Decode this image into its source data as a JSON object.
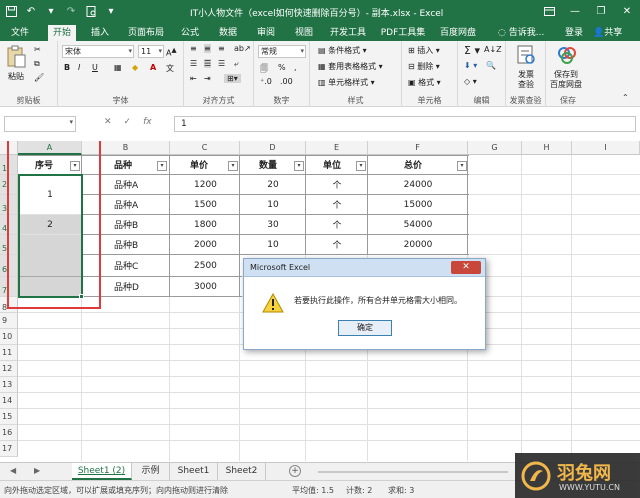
{
  "window": {
    "title": "IT小人物文件（excel如何快速删除百分号）- 副本.xlsx - Excel",
    "share_label": "共享",
    "login_label": "登录",
    "tell_me_placeholder": "告诉我..."
  },
  "tabs": [
    "文件",
    "开始",
    "插入",
    "页面布局",
    "公式",
    "数据",
    "审阅",
    "视图",
    "开发工具",
    "PDF工具集",
    "百度网盘"
  ],
  "active_tab": "开始",
  "ribbon": {
    "paste_label": "粘贴",
    "clipboard_label": "剪贴板",
    "font_name": "宋体",
    "font_size": "11",
    "font_label": "字体",
    "align_label": "对齐方式",
    "number_format": "常规",
    "number_label": "数字",
    "cond_format": "条件格式",
    "table_format": "套用表格格式",
    "cell_style": "单元格样式",
    "styles_label": "样式",
    "insert_label": "插入",
    "delete_label": "删除",
    "format_label": "格式",
    "cells_label": "单元格",
    "edit_label": "编辑",
    "invoice_label": "发票\n查验",
    "invoice_l1": "发票",
    "invoice_l2": "查验",
    "invoice_group": "发票查验",
    "save_l1": "保存到",
    "save_l2": "百度网盘",
    "save_group": "保存"
  },
  "formula_bar": {
    "name_box": "",
    "formula": "1",
    "fx": "fx"
  },
  "columns": [
    "A",
    "B",
    "C",
    "D",
    "E",
    "F",
    "G",
    "H",
    "I"
  ],
  "rows": [
    "1",
    "2",
    "3",
    "4",
    "5",
    "6",
    "7",
    "8",
    "9",
    "10",
    "11",
    "12",
    "13",
    "14",
    "15",
    "16",
    "17"
  ],
  "table": {
    "headers": [
      "序号",
      "品种",
      "单价",
      "数量",
      "单位",
      "总价"
    ],
    "seq_values": [
      "1",
      "2"
    ],
    "rows": [
      [
        "品种A",
        "1200",
        "20",
        "个",
        "24000"
      ],
      [
        "品种A",
        "1500",
        "10",
        "个",
        "15000"
      ],
      [
        "品种B",
        "1800",
        "30",
        "个",
        "54000"
      ],
      [
        "品种B",
        "2000",
        "10",
        "个",
        "20000"
      ],
      [
        "品种C",
        "2500",
        "",
        "",
        ""
      ],
      [
        "品种D",
        "3000",
        "",
        "",
        ""
      ]
    ]
  },
  "dialog": {
    "title": "Microsoft Excel",
    "message": "若要执行此操作，所有合并单元格需大小相同。",
    "ok_label": "确定",
    "close_symbol": "✕"
  },
  "sheets": [
    "Sheet1 (2)",
    "示例",
    "Sheet1",
    "Sheet2"
  ],
  "active_sheet": "Sheet1 (2)",
  "status": {
    "left": "向外拖动选定区域，可以扩展或填充序列；向内拖动则进行清除",
    "average": "平均值: 1.5",
    "count": "计数: 2",
    "sum": "求和: 3"
  },
  "watermark": {
    "brand": "羽兔网",
    "url": "WWW.YUTU.CN"
  },
  "colors": {
    "excel_green": "#217346",
    "highlight_red": "#e03a3a",
    "watermark_gold": "#f2b33d"
  }
}
